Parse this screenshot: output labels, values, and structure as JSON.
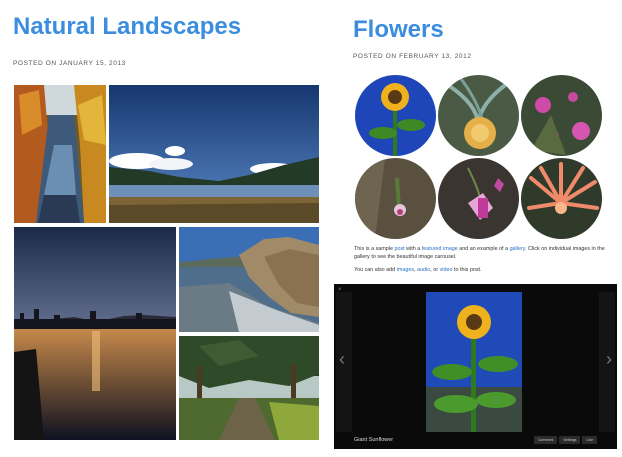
{
  "theme": {
    "title_color": "#3b8de0",
    "link_color": "#2a6fc9",
    "text_color": "#333333",
    "meta_color": "#555555",
    "carousel_bg": "#0a0a0a"
  },
  "post_left": {
    "title": "Natural Landscapes",
    "meta": "POSTED ON JANUARY 15, 2013",
    "photos": [
      "autumn-creek-photo",
      "blue-lake-photo",
      "sunset-lake-photo",
      "rocky-coast-photo",
      "tree-path-photo"
    ]
  },
  "post_right": {
    "title": "Flowers",
    "meta": "POSTED ON FEBRUARY 13, 2012",
    "gallery": [
      "sunflower-thumb",
      "protea-thumb",
      "purple-flowers-thumb",
      "small-flower-thumb",
      "fuchsia-thumb",
      "orange-spiky-flower-thumb"
    ],
    "para1": {
      "t1": "This is a sample ",
      "link1": "post",
      "t2": " with a ",
      "link2": "featured image",
      "t3": " and an example of a ",
      "link3": "gallery",
      "t4": ". Click on individual images in the gallery to see the beautiful image carousel."
    },
    "para2": {
      "t1": "You can also add ",
      "link1": "images",
      "t2": ", ",
      "link2": "audio",
      "t3": ", or ",
      "link3": "video",
      "t4": " to this post."
    },
    "carousel": {
      "close_icon": "close-icon",
      "prev_icon": "chevron-left-icon",
      "next_icon": "chevron-right-icon",
      "prev_glyph": "‹",
      "next_glyph": "›",
      "close_glyph": "×",
      "caption": "Giant Sunflower",
      "buttons": [
        "Comment",
        "Settings",
        "Like"
      ]
    }
  }
}
